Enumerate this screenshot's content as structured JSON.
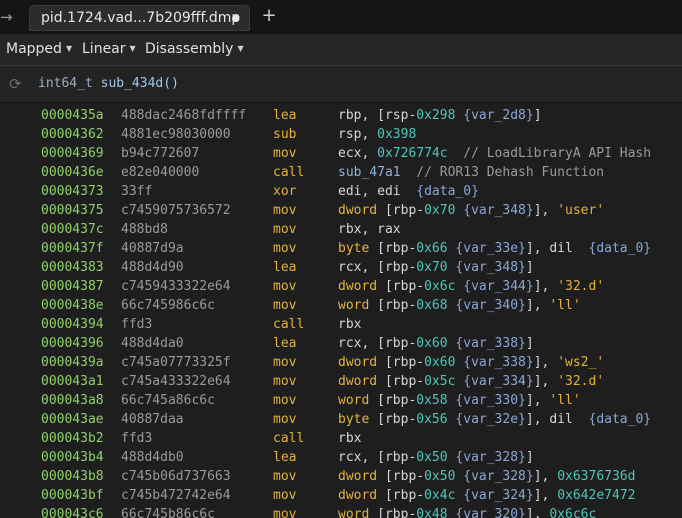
{
  "tab": {
    "title": "pid.1724.vad...7b209fff.dmp"
  },
  "toolbar": {
    "mapped_label": "Mapped",
    "linear_label": "Linear",
    "disassembly_label": "Disassembly"
  },
  "header": {
    "return_type": "int64_t",
    "function_name": "sub_434d()"
  },
  "rows": [
    {
      "addr": "0000435a",
      "bytes": "488dac2468fdffff",
      "mn": "lea",
      "ops": [
        [
          "r",
          "rbp, ["
        ],
        [
          "r",
          "rsp-"
        ],
        [
          "h",
          "0x298"
        ],
        [
          "r",
          " "
        ],
        [
          "v",
          "{var_2d8}"
        ],
        [
          "r",
          "]"
        ]
      ]
    },
    {
      "addr": "00004362",
      "bytes": "4881ec98030000",
      "mn": "sub",
      "ops": [
        [
          "r",
          "rsp, "
        ],
        [
          "h",
          "0x398"
        ]
      ]
    },
    {
      "addr": "00004369",
      "bytes": "b94c772607",
      "mn": "mov",
      "ops": [
        [
          "r",
          "ecx, "
        ],
        [
          "h",
          "0x726774c"
        ],
        [
          "c",
          "  // LoadLibraryA API Hash"
        ]
      ]
    },
    {
      "addr": "0000436e",
      "bytes": "e82e040000",
      "mn": "call",
      "ops": [
        [
          "f",
          "sub_47a1"
        ],
        [
          "c",
          "  // ROR13 Dehash Function"
        ]
      ]
    },
    {
      "addr": "00004373",
      "bytes": "33ff",
      "mn": "xor",
      "ops": [
        [
          "r",
          "edi, edi  "
        ],
        [
          "v",
          "{data_0}"
        ]
      ]
    },
    {
      "addr": "00004375",
      "bytes": "c7459075736572",
      "mn": "mov",
      "ops": [
        [
          "k",
          "dword"
        ],
        [
          "r",
          " [rbp-"
        ],
        [
          "h",
          "0x70"
        ],
        [
          "r",
          " "
        ],
        [
          "v",
          "{var_348}"
        ],
        [
          "r",
          "], "
        ],
        [
          "s",
          "'user'"
        ]
      ]
    },
    {
      "addr": "0000437c",
      "bytes": "488bd8",
      "mn": "mov",
      "ops": [
        [
          "r",
          "rbx, rax"
        ]
      ]
    },
    {
      "addr": "0000437f",
      "bytes": "40887d9a",
      "mn": "mov",
      "ops": [
        [
          "k",
          "byte"
        ],
        [
          "r",
          " [rbp-"
        ],
        [
          "h",
          "0x66"
        ],
        [
          "r",
          " "
        ],
        [
          "v",
          "{var_33e}"
        ],
        [
          "r",
          "], dil  "
        ],
        [
          "v",
          "{data_0}"
        ]
      ]
    },
    {
      "addr": "00004383",
      "bytes": "488d4d90",
      "mn": "lea",
      "ops": [
        [
          "r",
          "rcx, [rbp-"
        ],
        [
          "h",
          "0x70"
        ],
        [
          "r",
          " "
        ],
        [
          "v",
          "{var_348}"
        ],
        [
          "r",
          "]"
        ]
      ]
    },
    {
      "addr": "00004387",
      "bytes": "c7459433322e64",
      "mn": "mov",
      "ops": [
        [
          "k",
          "dword"
        ],
        [
          "r",
          " [rbp-"
        ],
        [
          "h",
          "0x6c"
        ],
        [
          "r",
          " "
        ],
        [
          "v",
          "{var_344}"
        ],
        [
          "r",
          "], "
        ],
        [
          "s",
          "'32.d'"
        ]
      ]
    },
    {
      "addr": "0000438e",
      "bytes": "66c745986c6c",
      "mn": "mov",
      "ops": [
        [
          "k",
          "word"
        ],
        [
          "r",
          " [rbp-"
        ],
        [
          "h",
          "0x68"
        ],
        [
          "r",
          " "
        ],
        [
          "v",
          "{var_340}"
        ],
        [
          "r",
          "], "
        ],
        [
          "s",
          "'ll'"
        ]
      ]
    },
    {
      "addr": "00004394",
      "bytes": "ffd3",
      "mn": "call",
      "ops": [
        [
          "r",
          "rbx"
        ]
      ]
    },
    {
      "addr": "00004396",
      "bytes": "488d4da0",
      "mn": "lea",
      "ops": [
        [
          "r",
          "rcx, [rbp-"
        ],
        [
          "h",
          "0x60"
        ],
        [
          "r",
          " "
        ],
        [
          "v",
          "{var_338}"
        ],
        [
          "r",
          "]"
        ]
      ]
    },
    {
      "addr": "0000439a",
      "bytes": "c745a07773325f",
      "mn": "mov",
      "ops": [
        [
          "k",
          "dword"
        ],
        [
          "r",
          " [rbp-"
        ],
        [
          "h",
          "0x60"
        ],
        [
          "r",
          " "
        ],
        [
          "v",
          "{var_338}"
        ],
        [
          "r",
          "], "
        ],
        [
          "s",
          "'ws2_'"
        ]
      ]
    },
    {
      "addr": "000043a1",
      "bytes": "c745a433322e64",
      "mn": "mov",
      "ops": [
        [
          "k",
          "dword"
        ],
        [
          "r",
          " [rbp-"
        ],
        [
          "h",
          "0x5c"
        ],
        [
          "r",
          " "
        ],
        [
          "v",
          "{var_334}"
        ],
        [
          "r",
          "], "
        ],
        [
          "s",
          "'32.d'"
        ]
      ]
    },
    {
      "addr": "000043a8",
      "bytes": "66c745a86c6c",
      "mn": "mov",
      "ops": [
        [
          "k",
          "word"
        ],
        [
          "r",
          " [rbp-"
        ],
        [
          "h",
          "0x58"
        ],
        [
          "r",
          " "
        ],
        [
          "v",
          "{var_330}"
        ],
        [
          "r",
          "], "
        ],
        [
          "s",
          "'ll'"
        ]
      ]
    },
    {
      "addr": "000043ae",
      "bytes": "40887daa",
      "mn": "mov",
      "ops": [
        [
          "k",
          "byte"
        ],
        [
          "r",
          " [rbp-"
        ],
        [
          "h",
          "0x56"
        ],
        [
          "r",
          " "
        ],
        [
          "v",
          "{var_32e}"
        ],
        [
          "r",
          "], dil  "
        ],
        [
          "v",
          "{data_0}"
        ]
      ]
    },
    {
      "addr": "000043b2",
      "bytes": "ffd3",
      "mn": "call",
      "ops": [
        [
          "r",
          "rbx"
        ]
      ]
    },
    {
      "addr": "000043b4",
      "bytes": "488d4db0",
      "mn": "lea",
      "ops": [
        [
          "r",
          "rcx, [rbp-"
        ],
        [
          "h",
          "0x50"
        ],
        [
          "r",
          " "
        ],
        [
          "v",
          "{var_328}"
        ],
        [
          "r",
          "]"
        ]
      ]
    },
    {
      "addr": "000043b8",
      "bytes": "c745b06d737663",
      "mn": "mov",
      "ops": [
        [
          "k",
          "dword"
        ],
        [
          "r",
          " [rbp-"
        ],
        [
          "h",
          "0x50"
        ],
        [
          "r",
          " "
        ],
        [
          "v",
          "{var_328}"
        ],
        [
          "r",
          "], "
        ],
        [
          "h",
          "0x6376736d"
        ]
      ]
    },
    {
      "addr": "000043bf",
      "bytes": "c745b472742e64",
      "mn": "mov",
      "ops": [
        [
          "k",
          "dword"
        ],
        [
          "r",
          " [rbp-"
        ],
        [
          "h",
          "0x4c"
        ],
        [
          "r",
          " "
        ],
        [
          "v",
          "{var_324}"
        ],
        [
          "r",
          "], "
        ],
        [
          "h",
          "0x642e7472"
        ]
      ]
    },
    {
      "addr": "000043c6",
      "bytes": "66c745b86c6c",
      "mn": "mov",
      "ops": [
        [
          "k",
          "word"
        ],
        [
          "r",
          " [rbp-"
        ],
        [
          "h",
          "0x48"
        ],
        [
          "r",
          " "
        ],
        [
          "v",
          "{var_320}"
        ],
        [
          "r",
          "], "
        ],
        [
          "h",
          "0x6c6c"
        ]
      ]
    }
  ]
}
